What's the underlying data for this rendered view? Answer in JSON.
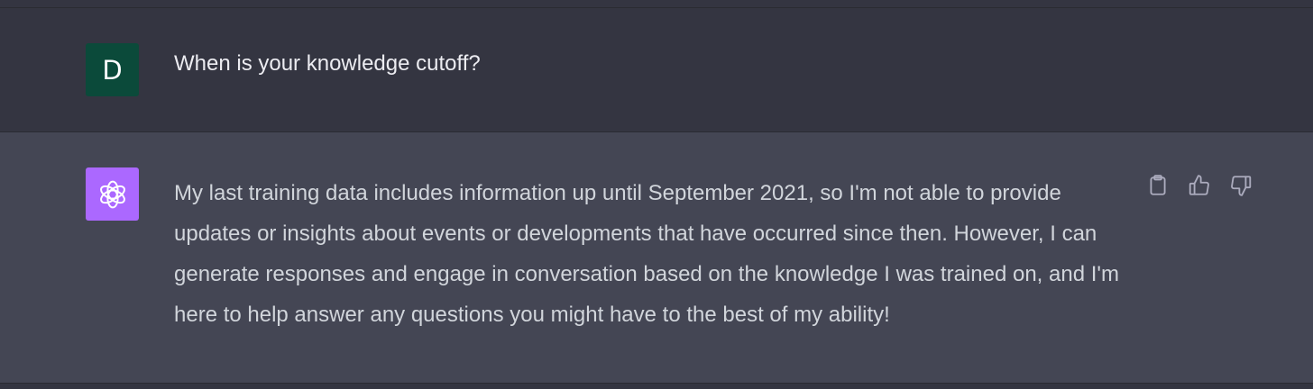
{
  "conversation": {
    "messages": [
      {
        "role": "user",
        "avatar": {
          "initial": "D",
          "color": "#0b4a3a"
        },
        "text": "When is your knowledge cutoff?"
      },
      {
        "role": "assistant",
        "avatar": {
          "icon": "openai-logo-icon",
          "color": "#ab68ff"
        },
        "text": "My last training data includes information up until September 2021, so I'm not able to provide updates or insights about events or developments that have occurred since then. However, I can generate responses and engage in conversation based on the knowledge I was trained on, and I'm here to help answer any questions you might have to the best of my ability!",
        "actions": [
          {
            "name": "copy",
            "icon": "clipboard-icon"
          },
          {
            "name": "thumbs-up",
            "icon": "thumbs-up-icon"
          },
          {
            "name": "thumbs-down",
            "icon": "thumbs-down-icon"
          }
        ]
      }
    ]
  },
  "colors": {
    "user_background": "#343541",
    "assistant_background": "#444654",
    "user_text": "#ececf1",
    "assistant_text": "#d1d5db",
    "icon": "#acacbe"
  }
}
